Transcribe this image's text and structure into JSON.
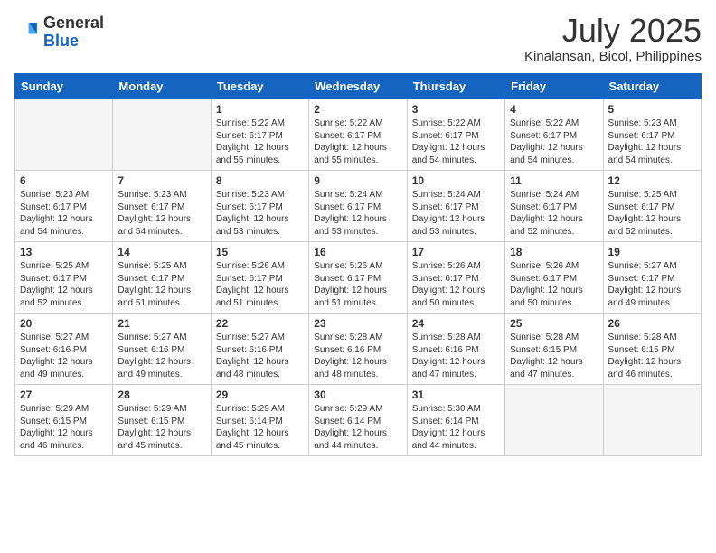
{
  "logo": {
    "general": "General",
    "blue": "Blue"
  },
  "title": {
    "month_year": "July 2025",
    "location": "Kinalansan, Bicol, Philippines"
  },
  "days_of_week": [
    "Sunday",
    "Monday",
    "Tuesday",
    "Wednesday",
    "Thursday",
    "Friday",
    "Saturday"
  ],
  "weeks": [
    [
      {
        "num": "",
        "sunrise": "",
        "sunset": "",
        "daylight": "",
        "empty": true
      },
      {
        "num": "",
        "sunrise": "",
        "sunset": "",
        "daylight": "",
        "empty": true
      },
      {
        "num": "1",
        "sunrise": "Sunrise: 5:22 AM",
        "sunset": "Sunset: 6:17 PM",
        "daylight": "Daylight: 12 hours and 55 minutes."
      },
      {
        "num": "2",
        "sunrise": "Sunrise: 5:22 AM",
        "sunset": "Sunset: 6:17 PM",
        "daylight": "Daylight: 12 hours and 55 minutes."
      },
      {
        "num": "3",
        "sunrise": "Sunrise: 5:22 AM",
        "sunset": "Sunset: 6:17 PM",
        "daylight": "Daylight: 12 hours and 54 minutes."
      },
      {
        "num": "4",
        "sunrise": "Sunrise: 5:22 AM",
        "sunset": "Sunset: 6:17 PM",
        "daylight": "Daylight: 12 hours and 54 minutes."
      },
      {
        "num": "5",
        "sunrise": "Sunrise: 5:23 AM",
        "sunset": "Sunset: 6:17 PM",
        "daylight": "Daylight: 12 hours and 54 minutes."
      }
    ],
    [
      {
        "num": "6",
        "sunrise": "Sunrise: 5:23 AM",
        "sunset": "Sunset: 6:17 PM",
        "daylight": "Daylight: 12 hours and 54 minutes."
      },
      {
        "num": "7",
        "sunrise": "Sunrise: 5:23 AM",
        "sunset": "Sunset: 6:17 PM",
        "daylight": "Daylight: 12 hours and 54 minutes."
      },
      {
        "num": "8",
        "sunrise": "Sunrise: 5:23 AM",
        "sunset": "Sunset: 6:17 PM",
        "daylight": "Daylight: 12 hours and 53 minutes."
      },
      {
        "num": "9",
        "sunrise": "Sunrise: 5:24 AM",
        "sunset": "Sunset: 6:17 PM",
        "daylight": "Daylight: 12 hours and 53 minutes."
      },
      {
        "num": "10",
        "sunrise": "Sunrise: 5:24 AM",
        "sunset": "Sunset: 6:17 PM",
        "daylight": "Daylight: 12 hours and 53 minutes."
      },
      {
        "num": "11",
        "sunrise": "Sunrise: 5:24 AM",
        "sunset": "Sunset: 6:17 PM",
        "daylight": "Daylight: 12 hours and 52 minutes."
      },
      {
        "num": "12",
        "sunrise": "Sunrise: 5:25 AM",
        "sunset": "Sunset: 6:17 PM",
        "daylight": "Daylight: 12 hours and 52 minutes."
      }
    ],
    [
      {
        "num": "13",
        "sunrise": "Sunrise: 5:25 AM",
        "sunset": "Sunset: 6:17 PM",
        "daylight": "Daylight: 12 hours and 52 minutes."
      },
      {
        "num": "14",
        "sunrise": "Sunrise: 5:25 AM",
        "sunset": "Sunset: 6:17 PM",
        "daylight": "Daylight: 12 hours and 51 minutes."
      },
      {
        "num": "15",
        "sunrise": "Sunrise: 5:26 AM",
        "sunset": "Sunset: 6:17 PM",
        "daylight": "Daylight: 12 hours and 51 minutes."
      },
      {
        "num": "16",
        "sunrise": "Sunrise: 5:26 AM",
        "sunset": "Sunset: 6:17 PM",
        "daylight": "Daylight: 12 hours and 51 minutes."
      },
      {
        "num": "17",
        "sunrise": "Sunrise: 5:26 AM",
        "sunset": "Sunset: 6:17 PM",
        "daylight": "Daylight: 12 hours and 50 minutes."
      },
      {
        "num": "18",
        "sunrise": "Sunrise: 5:26 AM",
        "sunset": "Sunset: 6:17 PM",
        "daylight": "Daylight: 12 hours and 50 minutes."
      },
      {
        "num": "19",
        "sunrise": "Sunrise: 5:27 AM",
        "sunset": "Sunset: 6:17 PM",
        "daylight": "Daylight: 12 hours and 49 minutes."
      }
    ],
    [
      {
        "num": "20",
        "sunrise": "Sunrise: 5:27 AM",
        "sunset": "Sunset: 6:16 PM",
        "daylight": "Daylight: 12 hours and 49 minutes."
      },
      {
        "num": "21",
        "sunrise": "Sunrise: 5:27 AM",
        "sunset": "Sunset: 6:16 PM",
        "daylight": "Daylight: 12 hours and 49 minutes."
      },
      {
        "num": "22",
        "sunrise": "Sunrise: 5:27 AM",
        "sunset": "Sunset: 6:16 PM",
        "daylight": "Daylight: 12 hours and 48 minutes."
      },
      {
        "num": "23",
        "sunrise": "Sunrise: 5:28 AM",
        "sunset": "Sunset: 6:16 PM",
        "daylight": "Daylight: 12 hours and 48 minutes."
      },
      {
        "num": "24",
        "sunrise": "Sunrise: 5:28 AM",
        "sunset": "Sunset: 6:16 PM",
        "daylight": "Daylight: 12 hours and 47 minutes."
      },
      {
        "num": "25",
        "sunrise": "Sunrise: 5:28 AM",
        "sunset": "Sunset: 6:15 PM",
        "daylight": "Daylight: 12 hours and 47 minutes."
      },
      {
        "num": "26",
        "sunrise": "Sunrise: 5:28 AM",
        "sunset": "Sunset: 6:15 PM",
        "daylight": "Daylight: 12 hours and 46 minutes."
      }
    ],
    [
      {
        "num": "27",
        "sunrise": "Sunrise: 5:29 AM",
        "sunset": "Sunset: 6:15 PM",
        "daylight": "Daylight: 12 hours and 46 minutes."
      },
      {
        "num": "28",
        "sunrise": "Sunrise: 5:29 AM",
        "sunset": "Sunset: 6:15 PM",
        "daylight": "Daylight: 12 hours and 45 minutes."
      },
      {
        "num": "29",
        "sunrise": "Sunrise: 5:29 AM",
        "sunset": "Sunset: 6:14 PM",
        "daylight": "Daylight: 12 hours and 45 minutes."
      },
      {
        "num": "30",
        "sunrise": "Sunrise: 5:29 AM",
        "sunset": "Sunset: 6:14 PM",
        "daylight": "Daylight: 12 hours and 44 minutes."
      },
      {
        "num": "31",
        "sunrise": "Sunrise: 5:30 AM",
        "sunset": "Sunset: 6:14 PM",
        "daylight": "Daylight: 12 hours and 44 minutes."
      },
      {
        "num": "",
        "sunrise": "",
        "sunset": "",
        "daylight": "",
        "empty": true
      },
      {
        "num": "",
        "sunrise": "",
        "sunset": "",
        "daylight": "",
        "empty": true
      }
    ]
  ]
}
